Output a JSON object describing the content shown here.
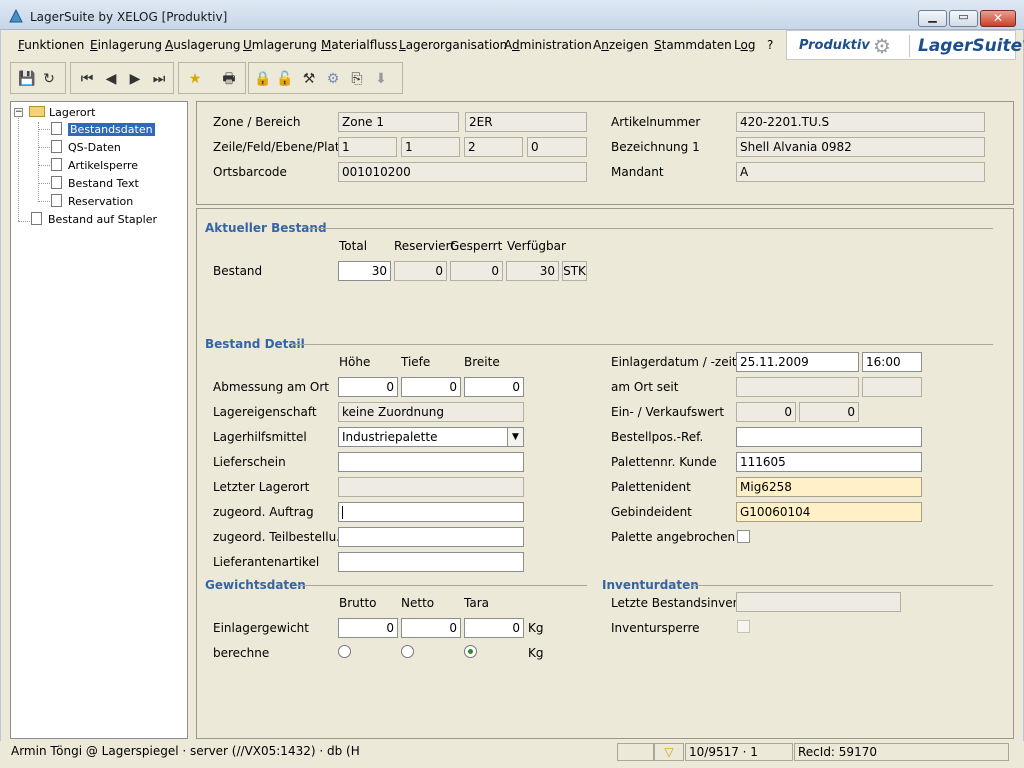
{
  "window": {
    "title": "LagerSuite by XELOG [Produktiv]"
  },
  "menu": [
    {
      "pre": "",
      "u": "F",
      "post": "unktionen"
    },
    {
      "pre": "",
      "u": "E",
      "post": "inlagerung"
    },
    {
      "pre": "",
      "u": "A",
      "post": "uslagerung"
    },
    {
      "pre": "",
      "u": "U",
      "post": "mlagerung"
    },
    {
      "pre": "",
      "u": "M",
      "post": "aterialfluss"
    },
    {
      "pre": "",
      "u": "L",
      "post": "agerorganisation"
    },
    {
      "pre": "A",
      "u": "d",
      "post": "ministration"
    },
    {
      "pre": "A",
      "u": "n",
      "post": "zeigen"
    },
    {
      "pre": "",
      "u": "S",
      "post": "tammdaten"
    },
    {
      "pre": "L",
      "u": "o",
      "post": "g"
    },
    {
      "pre": "?",
      "u": "",
      "post": ""
    }
  ],
  "brand": {
    "mode": "Produktiv",
    "logo": "LagerSuite",
    "logo_mark": "®"
  },
  "tree": {
    "root": "Lagerort",
    "children": [
      "Bestandsdaten",
      "QS-Daten",
      "Artikelsperre",
      "Bestand Text",
      "Reservation"
    ],
    "selected": "Bestandsdaten",
    "sibling": "Bestand auf Stapler"
  },
  "location": {
    "zone_label": "Zone / Bereich",
    "zone": "Zone 1",
    "bereich": "2ER",
    "zfep_label": "Zeile/Feld/Ebene/Platz",
    "zeile": "1",
    "feld": "1",
    "ebene": "2",
    "platz": "0",
    "barcode_label": "Ortsbarcode",
    "barcode": "001010200",
    "artikelnr_label": "Artikelnummer",
    "artikelnr": "420-2201.TU.S",
    "bezeichnung_label": "Bezeichnung 1",
    "bezeichnung": "Shell Alvania 0982",
    "mandant_label": "Mandant",
    "mandant": "A"
  },
  "bestand": {
    "section": "Aktueller Bestand",
    "headers": {
      "total": "Total",
      "reserviert": "Reserviert",
      "gesperrt": "Gesperrt",
      "verfuegbar": "Verfügbar"
    },
    "row_label": "Bestand",
    "total": "30",
    "reserviert": "0",
    "gesperrt": "0",
    "verfuegbar": "30",
    "unit": "STK"
  },
  "detail": {
    "section": "Bestand Detail",
    "headers": {
      "hoehe": "Höhe",
      "tiefe": "Tiefe",
      "breite": "Breite"
    },
    "abmessung_label": "Abmessung am Ort",
    "hoehe": "0",
    "tiefe": "0",
    "breite": "0",
    "lagereigenschaft_label": "Lagereigenschaft",
    "lagereigenschaft": "keine Zuordnung",
    "lagerhilfsmittel_label": "Lagerhilfsmittel",
    "lagerhilfsmittel": "Industriepalette",
    "lieferschein_label": "Lieferschein",
    "lieferschein": "",
    "letzter_lagerort_label": "Letzter Lagerort",
    "letzter_lagerort": "",
    "auftrag_label": "zugeord. Auftrag",
    "auftrag": "",
    "teilbestellung_label": "zugeord. Teilbestellu...",
    "teilbestellung": "",
    "lieferantenartikel_label": "Lieferantenartikel",
    "lieferantenartikel": "",
    "einlagerdatum_label": "Einlagerdatum / -zeit",
    "einlagerdatum": "25.11.2009",
    "einlagerzeit": "16:00",
    "amortseit_label": "am Ort seit",
    "amortseit_date": "",
    "amortseit_time": "",
    "verkaufswert_label": "Ein- / Verkaufswert",
    "einwert": "0",
    "verkaufswert": "0",
    "bestellpos_label": "Bestellpos.-Ref.",
    "bestellpos": "",
    "palettennr_label": "Palettennr. Kunde",
    "palettennr": "111605",
    "palettenident_label": "Palettenident",
    "palettenident": "Mig6258",
    "gebindeident_label": "Gebindeident",
    "gebindeident": "G10060104",
    "angebrochen_label": "Palette angebrochen"
  },
  "gewicht": {
    "section": "Gewichtsdaten",
    "headers": {
      "brutto": "Brutto",
      "netto": "Netto",
      "tara": "Tara"
    },
    "einlager_label": "Einlagergewicht",
    "brutto": "0",
    "netto": "0",
    "tara": "0",
    "unit": "Kg",
    "berechne_label": "berechne",
    "berechne_unit": "Kg",
    "berechne_selected": "tara"
  },
  "inventur": {
    "section": "Inventurdaten",
    "letzte_label": "Letzte Bestandsinven...",
    "letzte": "",
    "sperre_label": "Inventursperre"
  },
  "status": {
    "user": "Armin Töngi @ Lagerspiegel · server (//VX05:1432) · db (H",
    "counter": "10/9517 · 1",
    "recid": "RecId: 59170"
  }
}
